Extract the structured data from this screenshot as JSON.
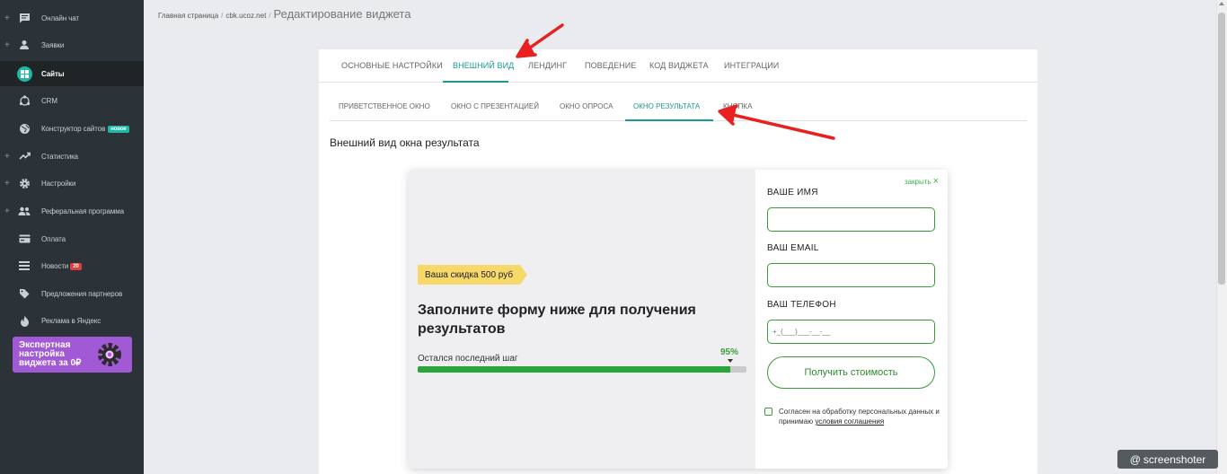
{
  "sidebar": {
    "items": [
      {
        "label": "Онлайн чат",
        "icon": "chat-icon",
        "has_plus": true
      },
      {
        "label": "Заявки",
        "icon": "person-icon",
        "has_plus": true
      },
      {
        "label": "Сайты",
        "icon": "grid-icon",
        "has_plus": false,
        "active": true
      },
      {
        "label": "CRM",
        "icon": "crm-icon",
        "has_plus": false
      },
      {
        "label": "Конструктор сайтов",
        "icon": "globe-icon",
        "has_plus": false,
        "badge": "новое"
      },
      {
        "label": "Статистика",
        "icon": "trend-icon",
        "has_plus": true
      },
      {
        "label": "Настройки",
        "icon": "gear-icon",
        "has_plus": true
      },
      {
        "label": "Реферальная программа",
        "icon": "people-icon",
        "has_plus": true
      },
      {
        "label": "Оплата",
        "icon": "card-icon",
        "has_plus": false
      },
      {
        "label": "Новости",
        "icon": "list-icon",
        "has_plus": false,
        "count": "20"
      },
      {
        "label": "Предложения партнеров",
        "icon": "tag-icon",
        "has_plus": false
      },
      {
        "label": "Реклама в Яндекс",
        "icon": "fire-icon",
        "has_plus": false
      }
    ],
    "plus_symbol": "+",
    "promo": {
      "text": "Экспертная настройка виджета за 0₽"
    }
  },
  "breadcrumb": {
    "home": "Главная страница",
    "separator": "/",
    "site": "cbk.ucoz.net",
    "current": "Редактирование виджета"
  },
  "tabs_main": [
    {
      "label": "ОСНОВНЫЕ НАСТРОЙКИ"
    },
    {
      "label": "ВНЕШНИЙ ВИД",
      "active": true
    },
    {
      "label": "ЛЕНДИНГ"
    },
    {
      "label": "ПОВЕДЕНИЕ"
    },
    {
      "label": "КОД ВИДЖЕТА"
    },
    {
      "label": "ИНТЕГРАЦИИ"
    }
  ],
  "tabs_sub": [
    {
      "label": "ПРИВЕТСТВЕННОЕ ОКНО"
    },
    {
      "label": "ОКНО С ПРЕЗЕНТАЦИЕЙ"
    },
    {
      "label": "ОКНО ОПРОСА"
    },
    {
      "label": "ОКНО РЕЗУЛЬТАТА",
      "active": true
    },
    {
      "label": "КНОПКА"
    }
  ],
  "section_title": "Внешний вид окна результата",
  "widget": {
    "discount": "Ваша скидка 500 руб",
    "heading": "Заполните форму ниже для получения результатов",
    "step_label": "Остался последний шаг",
    "progress_text": "95%",
    "progress_value": 0.95,
    "close_label": "закрыть",
    "close_icon": "×",
    "fields": [
      {
        "label": "ВАШЕ ИМЯ",
        "value": "",
        "placeholder": ""
      },
      {
        "label": "ВАШ EMAIL",
        "value": "",
        "placeholder": ""
      },
      {
        "label": "ВАШ ТЕЛЕФОН",
        "value": "",
        "placeholder": "+_(___)___-__-__"
      }
    ],
    "submit_label": "Получить стоимость",
    "consent_text": "Согласен на обработку персональных данных и принимаю",
    "consent_link": "условия соглашения",
    "consent_checked": false
  },
  "colors": {
    "accent": "#1a9a8f",
    "green": "#2aa53a",
    "sidebar_bg": "#2c3338",
    "promo_bg": "#a259d6",
    "discount_bg": "#f7d96b",
    "annotation_arrow": "#e8201f"
  },
  "watermark": {
    "symbol": "@",
    "text": "screenshoter"
  }
}
